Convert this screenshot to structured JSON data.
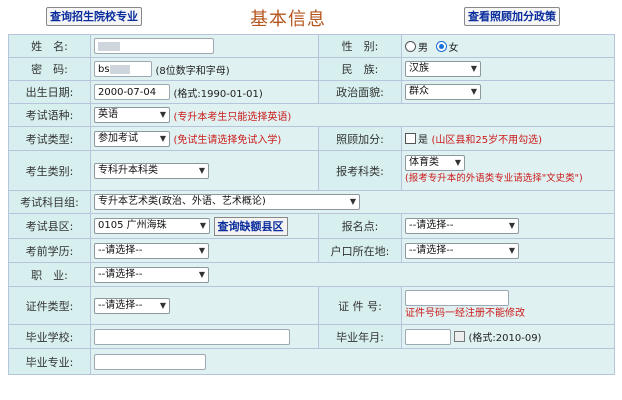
{
  "header": {
    "query_school_label": "查询招生院校专业",
    "title": "基本信息",
    "policy_label": "查看照顾加分政策"
  },
  "fields": {
    "name_label": "姓　名:",
    "name_value": "",
    "gender_label": "性　别:",
    "gender_options": [
      "男",
      "女"
    ],
    "password_label": "密　码:",
    "password_value": "bs",
    "password_hint": "(8位数字和字母)",
    "ethnicity_label": "民　族:",
    "ethnicity_value": "汉族",
    "birth_label": "出生日期:",
    "birth_value": "2000-07-04",
    "birth_hint": "(格式:1990-01-01)",
    "politics_label": "政治面貌:",
    "politics_value": "群众",
    "language_label": "考试语种:",
    "language_value": "英语",
    "language_hint": "(专升本考生只能选择英语)",
    "exam_type_label": "考试类型:",
    "exam_type_value": "参加考试",
    "exam_type_hint": "(免试生请选择免试入学)",
    "bonus_label": "照顾加分:",
    "bonus_check_label": "是",
    "bonus_hint": "(山区县和25岁不用勾选)",
    "category_label": "考生类别:",
    "category_value": "专科升本科类",
    "subject_label": "报考科类:",
    "subject_value": "体育类",
    "subject_hint": "(报考专升本的外语类专业请选择\"文史类\")",
    "group_label": "考试科目组:",
    "group_value": "专升本艺术类(政治、外语、艺术概论)",
    "district_label": "考试县区:",
    "district_value": "0105 广州海珠",
    "district_button": "查询缺额县区",
    "site_label": "报名点:",
    "site_value": "--请选择--",
    "education_label": "考前学历:",
    "education_value": "--请选择--",
    "hukou_label": "户口所在地:",
    "hukou_value": "--请选择--",
    "job_label": "职　业:",
    "job_value": "--请选择--",
    "id_type_label": "证件类型:",
    "id_type_value": "--请选择--",
    "id_no_label": "证 件 号:",
    "id_no_hint": "证件号码一经注册不能修改",
    "school_label": "毕业学校:",
    "grad_year_label": "毕业年月:",
    "grad_year_hint": "(格式:2010-09)",
    "major_label": "毕业专业:"
  }
}
